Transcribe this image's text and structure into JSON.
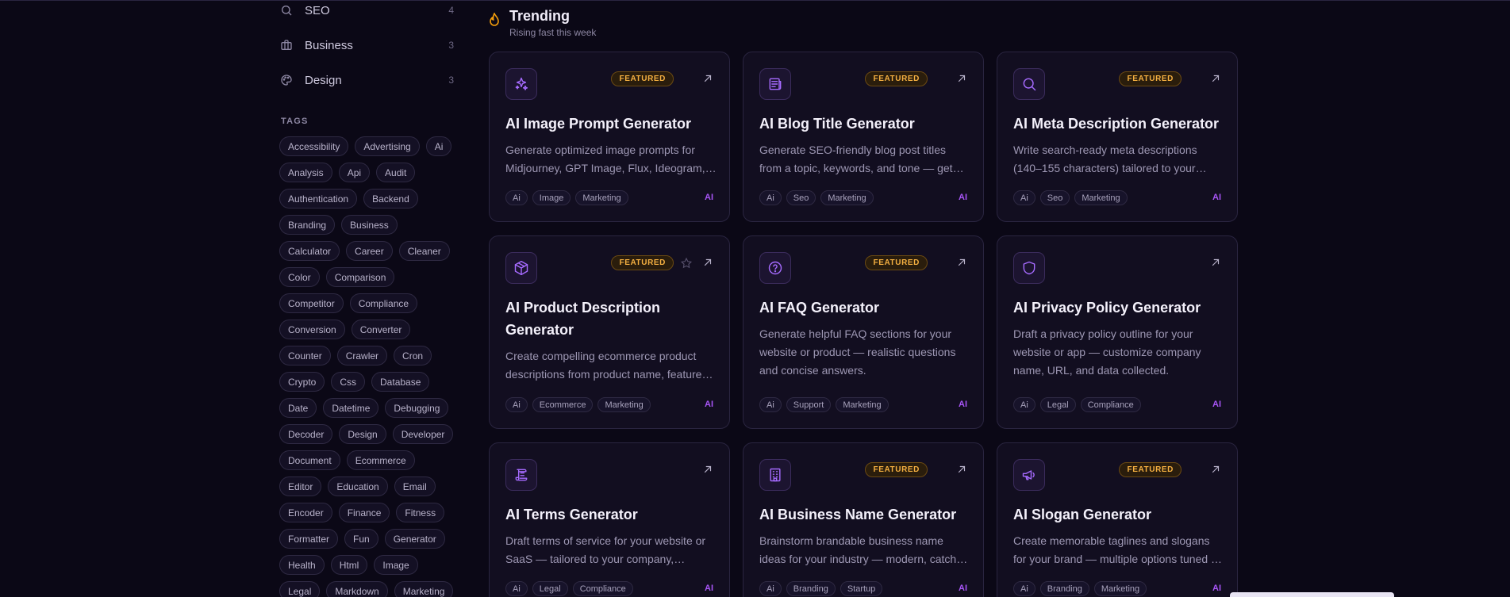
{
  "sidebar": {
    "categories": [
      {
        "label": "SEO",
        "count": "4",
        "icon": "search-icon"
      },
      {
        "label": "Business",
        "count": "3",
        "icon": "briefcase-icon"
      },
      {
        "label": "Design",
        "count": "3",
        "icon": "palette-icon"
      }
    ],
    "tags_title": "TAGS",
    "tags": [
      "Accessibility",
      "Advertising",
      "Ai",
      "Analysis",
      "Api",
      "Audit",
      "Authentication",
      "Backend",
      "Branding",
      "Business",
      "Calculator",
      "Career",
      "Cleaner",
      "Color",
      "Comparison",
      "Competitor",
      "Compliance",
      "Conversion",
      "Converter",
      "Counter",
      "Crawler",
      "Cron",
      "Crypto",
      "Css",
      "Database",
      "Date",
      "Datetime",
      "Debugging",
      "Decoder",
      "Design",
      "Developer",
      "Document",
      "Ecommerce",
      "Editor",
      "Education",
      "Email",
      "Encoder",
      "Finance",
      "Fitness",
      "Formatter",
      "Fun",
      "Generator",
      "Health",
      "Html",
      "Image",
      "Legal",
      "Markdown",
      "Marketing"
    ]
  },
  "section": {
    "title": "Trending",
    "subtitle": "Rising fast this week"
  },
  "featured_label": "FEATURED",
  "ai_label": "AI",
  "cards": [
    {
      "title": "AI Image Prompt Generator",
      "desc": "Generate optimized image prompts for Midjourney, GPT Image, Flux, Ideogram, and more.",
      "tags": [
        "Ai",
        "Image",
        "Marketing"
      ],
      "featured": true,
      "icon": "sparkles-icon"
    },
    {
      "title": "AI Blog Title Generator",
      "desc": "Generate SEO-friendly blog post titles from a topic, keywords, and tone — get dozens of options.",
      "tags": [
        "Ai",
        "Seo",
        "Marketing"
      ],
      "featured": true,
      "icon": "newspaper-icon"
    },
    {
      "title": "AI Meta Description Generator",
      "desc": "Write search-ready meta descriptions (140–155 characters) tailored to your page.",
      "tags": [
        "Ai",
        "Seo",
        "Marketing"
      ],
      "featured": true,
      "icon": "search-icon"
    },
    {
      "title": "AI Product Description Generator",
      "desc": "Create compelling ecommerce product descriptions from product name, features and audience.",
      "tags": [
        "Ai",
        "Ecommerce",
        "Marketing"
      ],
      "featured": true,
      "icon": "package-icon"
    },
    {
      "title": "AI FAQ Generator",
      "desc": "Generate helpful FAQ sections for your website or product — realistic questions and concise answers.",
      "tags": [
        "Ai",
        "Support",
        "Marketing"
      ],
      "featured": true,
      "icon": "help-circle-icon"
    },
    {
      "title": "AI Privacy Policy Generator",
      "desc": "Draft a privacy policy outline for your website or app — customize company name, URL, and data collected.",
      "tags": [
        "Ai",
        "Legal",
        "Compliance"
      ],
      "featured": false,
      "icon": "shield-icon"
    },
    {
      "title": "AI Terms Generator",
      "desc": "Draft terms of service for your website or SaaS — tailored to your company, jurisdiction and offering.",
      "tags": [
        "Ai",
        "Legal",
        "Compliance"
      ],
      "featured": false,
      "icon": "scroll-icon"
    },
    {
      "title": "AI Business Name Generator",
      "desc": "Brainstorm brandable business name ideas for your industry — modern, catchy and memorable.",
      "tags": [
        "Ai",
        "Branding",
        "Startup"
      ],
      "featured": true,
      "icon": "building-icon"
    },
    {
      "title": "AI Slogan Generator",
      "desc": "Create memorable taglines and slogans for your brand — multiple options tuned to your voice.",
      "tags": [
        "Ai",
        "Branding",
        "Marketing"
      ],
      "featured": true,
      "icon": "megaphone-icon"
    }
  ]
}
